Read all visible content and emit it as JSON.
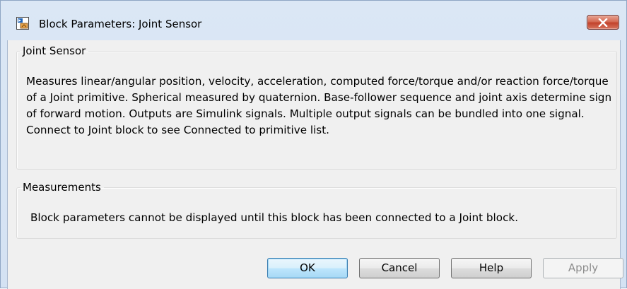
{
  "window": {
    "title": "Block Parameters: Joint Sensor"
  },
  "groups": {
    "joint_sensor": {
      "legend": "Joint Sensor",
      "description": "Measures linear/angular position, velocity, acceleration, computed force/torque and/or reaction force/torque of a Joint primitive. Spherical measured by quaternion. Base-follower sequence and joint axis determine sign of forward motion. Outputs are Simulink signals. Multiple output signals can be bundled into one signal. Connect to Joint block to see Connected to primitive list."
    },
    "measurements": {
      "legend": "Measurements",
      "message": "Block parameters cannot be displayed until this block has been connected to a Joint block."
    }
  },
  "buttons": {
    "ok": "OK",
    "cancel": "Cancel",
    "help": "Help",
    "apply": "Apply"
  },
  "icons": {
    "app": "simulink-block-icon",
    "close": "close-icon"
  },
  "colors": {
    "close_button": "#c2432c",
    "titlebar": "#d4e2f3",
    "client_background": "#f0f0f0"
  }
}
